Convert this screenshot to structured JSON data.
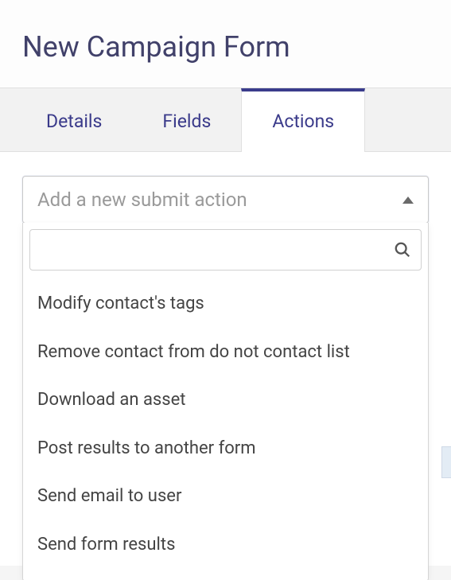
{
  "header": {
    "title": "New Campaign Form"
  },
  "tabs": [
    {
      "label": "Details",
      "name": "tab-details",
      "active": false
    },
    {
      "label": "Fields",
      "name": "tab-fields",
      "active": false
    },
    {
      "label": "Actions",
      "name": "tab-actions",
      "active": true
    }
  ],
  "actionSelect": {
    "placeholder": "Add a new submit action",
    "searchValue": "",
    "options": [
      "Modify contact's tags",
      "Remove contact from do not contact list",
      "Download an asset",
      "Post results to another form",
      "Send email to user",
      "Send form results"
    ]
  }
}
